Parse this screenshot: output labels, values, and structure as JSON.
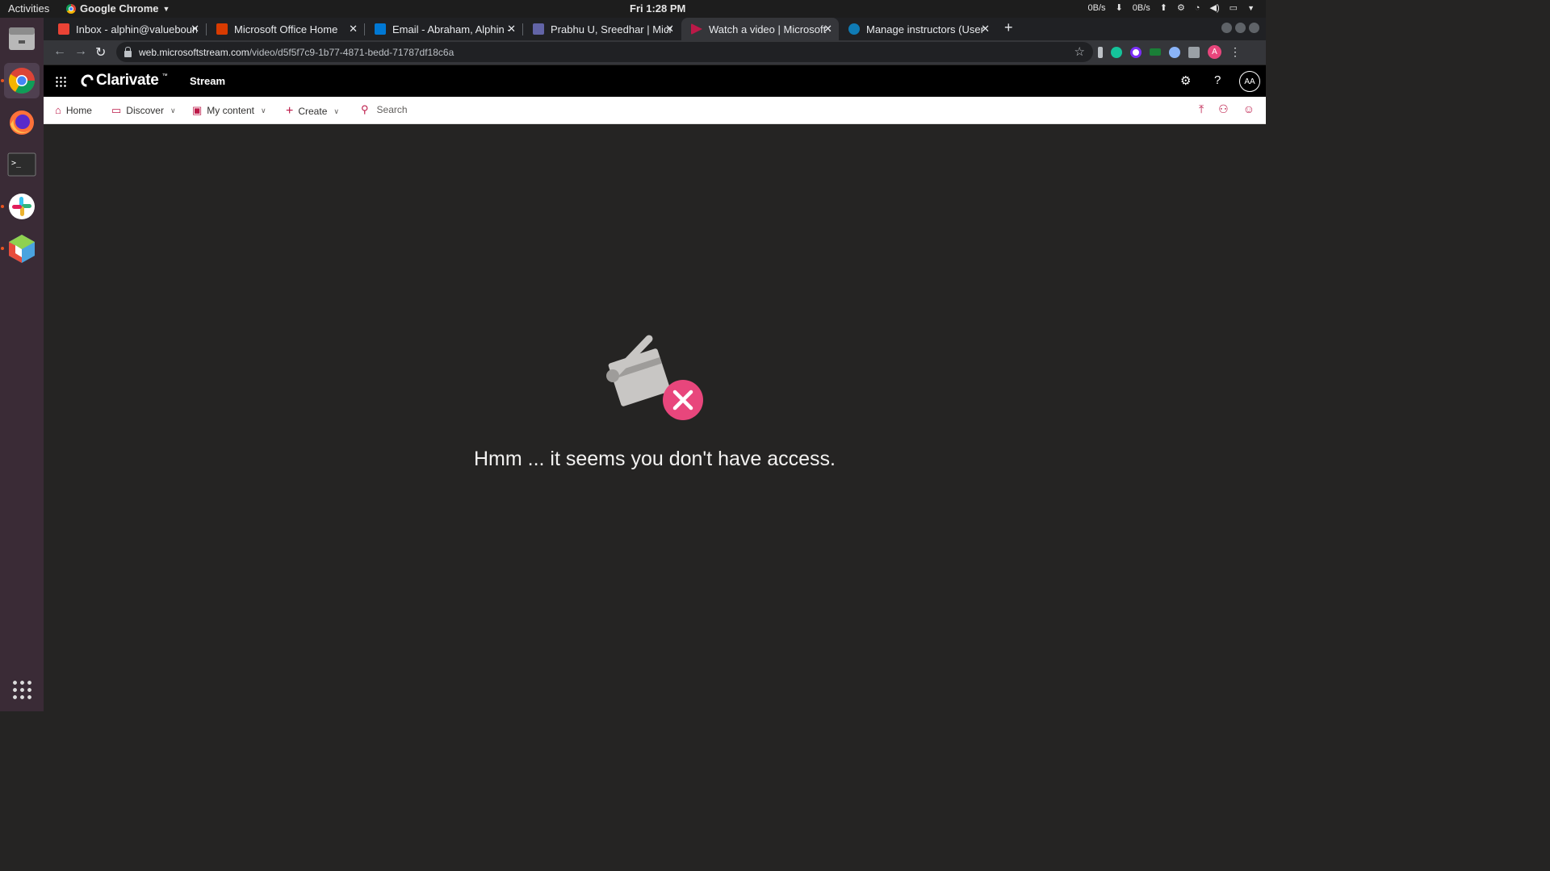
{
  "system": {
    "activities": "Activities",
    "app_name": "Google Chrome",
    "clock": "Fri  1:28 PM",
    "net_down": "0B/s",
    "net_up": "0B/s"
  },
  "browser": {
    "tabs": [
      {
        "label": "Inbox - alphin@valuebound",
        "favicon_color": "#ea4335",
        "active": false
      },
      {
        "label": "Microsoft Office Home",
        "favicon_color": "#d83b01",
        "active": false
      },
      {
        "label": "Email - Abraham, Alphin - Outlook",
        "favicon_color": "#0078d4",
        "active": false
      },
      {
        "label": "Prabhu U, Sreedhar | Microsoft Teams",
        "favicon_color": "#6264a7",
        "active": false
      },
      {
        "label": "Watch a video | Microsoft Stream",
        "favicon_color": "#bc1948",
        "active": true
      },
      {
        "label": "Manage instructors (User",
        "favicon_color": "#0f7bb5",
        "active": false
      }
    ],
    "url_domain": "web.microsoftstream.com",
    "url_path": "/video/d5f5f7c9-1b77-4871-bedd-71787df18c6a",
    "profile_initial": "A"
  },
  "stream": {
    "brand": "Clarivate",
    "trademark": "™",
    "product": "Stream",
    "avatar_initials": "AA",
    "nav": {
      "home": "Home",
      "discover": "Discover",
      "my_content": "My content",
      "create": "Create",
      "search_placeholder": "Search"
    },
    "error_message": "Hmm ... it seems you don't have access."
  },
  "colors": {
    "accent": "#bc1948",
    "error_badge": "#e8467c",
    "background": "#252423"
  }
}
